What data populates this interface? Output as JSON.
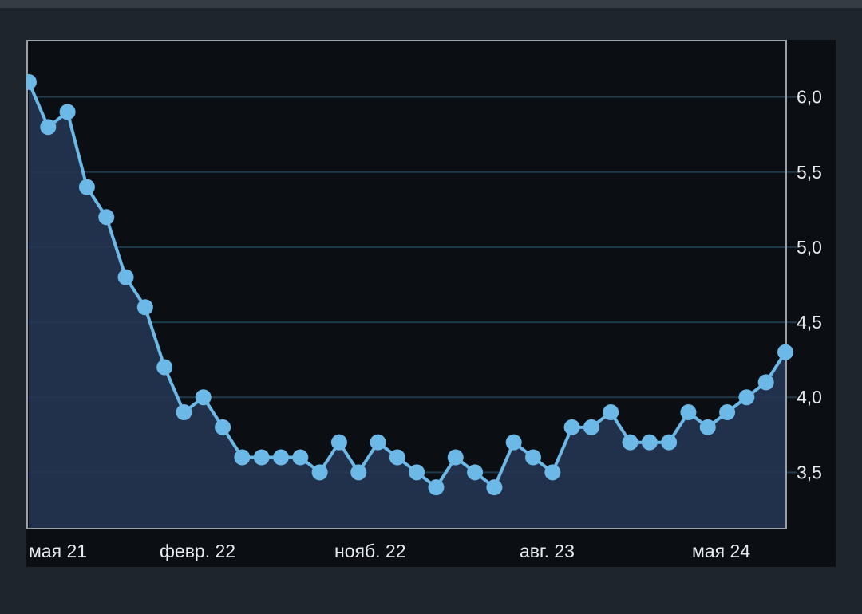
{
  "colors": {
    "background": "#1f252c",
    "panel": "#0b0e13",
    "line": "#6cb8e6",
    "fill": "#233552",
    "grid": "#1e3a4e",
    "frame": "#9aa0a6",
    "text": "#e8ecef"
  },
  "chart_data": {
    "type": "line",
    "x_labels": [
      "мая 21",
      "февр. 22",
      "нояб. 22",
      "авг. 23",
      "мая 24"
    ],
    "y_ticks": [
      "6,0",
      "5,5",
      "5,0",
      "4,5",
      "4,0",
      "3,5"
    ],
    "y_tick_values": [
      6.0,
      5.5,
      5.0,
      4.5,
      4.0,
      3.5
    ],
    "ylim": [
      3.13,
      6.37
    ],
    "grid": "horizontal",
    "y_axis_position": "right",
    "area_fill": true,
    "series": [
      {
        "values": [
          6.1,
          5.8,
          5.9,
          5.4,
          5.2,
          4.8,
          4.6,
          4.2,
          3.9,
          4.0,
          3.8,
          3.6,
          3.6,
          3.6,
          3.6,
          3.5,
          3.7,
          3.5,
          3.7,
          3.6,
          3.5,
          3.4,
          3.6,
          3.5,
          3.4,
          3.7,
          3.6,
          3.5,
          3.8,
          3.8,
          3.9,
          3.7,
          3.7,
          3.7,
          3.9,
          3.8,
          3.9,
          4.0,
          4.1,
          4.3
        ]
      }
    ]
  }
}
